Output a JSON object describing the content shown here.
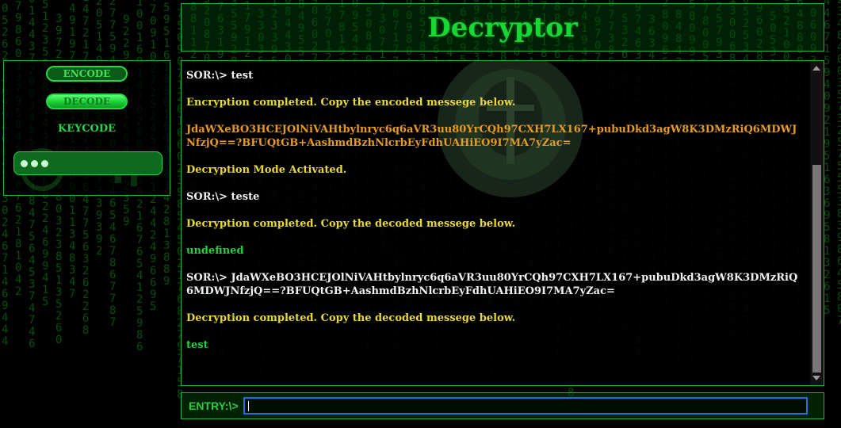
{
  "header": {
    "title": "Decryptor"
  },
  "controls": {
    "encode_label": "ENCODE",
    "decode_label": "DECODE",
    "keycode_label": "KEYCODE",
    "keycode_value_masked": "•••"
  },
  "console": {
    "lines": [
      {
        "type": "user",
        "text": "SOR:\\> test"
      },
      {
        "type": "msg",
        "text": "Encryption completed. Copy the encoded messege below."
      },
      {
        "type": "code",
        "text": "JdaWXeBO3HCEJOlNiVAHtbylnryc6q6aVR3uu80YrCQh97CXH7LX167+pubuDkd3agW8K3DMzRiQ6MDWJNfzjQ==?BFUQtGB+AashmdBzhNlcrbEyFdhUAHiEO9I7MA7yZac="
      },
      {
        "type": "msg",
        "text": "Decryption Mode Activated."
      },
      {
        "type": "user",
        "text": "SOR:\\> teste"
      },
      {
        "type": "msg",
        "text": "Decryption completed. Copy the decoded messege below."
      },
      {
        "type": "plain",
        "text": "undefined"
      },
      {
        "type": "user",
        "text": "SOR:\\> JdaWXeBO3HCEJOlNiVAHtbylnryc6q6aVR3uu80YrCQh97CXH7LX167+pubuDkd3agW8K3DMzRiQ6MDWJNfzjQ==?BFUQtGB+AashmdBzhNlcrbEyFdhUAHiEO9I7MA7yZac="
      },
      {
        "type": "msg",
        "text": "Decryption completed. Copy the decoded messege below."
      },
      {
        "type": "plain",
        "text": "test"
      }
    ]
  },
  "entry": {
    "label": "ENTRY:\\>",
    "value": ""
  },
  "colors": {
    "accent": "#1fb43a",
    "message": "#e8d83a",
    "code": "#e89a22",
    "user": "#f2f2f2"
  }
}
